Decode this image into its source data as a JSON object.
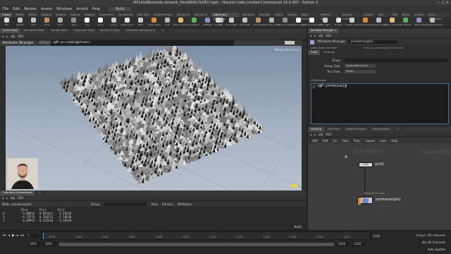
{
  "window": {
    "title": "/ATLAS/Work/edu-sk/work_files/BASICS/VEX.hiplc - Houdini Indie Limited-Commercial 19.0.455 - Python 3"
  },
  "menu": [
    "File",
    "Edit",
    "Render",
    "Assets",
    "Windows",
    "Arnold",
    "Help"
  ],
  "desktop": "Build",
  "shelf": {
    "left_tabs": [
      "Create",
      "Modify",
      "Model",
      "Polygon",
      "Deform",
      "Texture",
      "Rigging",
      "Characters",
      "Constraints",
      "Hair Utils",
      "Guide Process",
      "Terrain FX",
      "Simple FX",
      "Volume",
      "+"
    ],
    "right_tabs": [
      "Lights and Cameras",
      "Collisions",
      "Particles",
      "Grains",
      "Vellum",
      "Rigid Bodies",
      "Particle Fluids",
      "Viscous Fluids",
      "Oceans",
      "Pyro FX",
      "FEM",
      "Wires",
      "Crowds",
      "Drive Simulation"
    ],
    "left_tools": [
      "Box",
      "Sphere",
      "Tube",
      "Torus",
      "Grid",
      "Null",
      "Line",
      "Circle",
      "Curve",
      "Draw Curve",
      "Path",
      "Spray Paint",
      "Font",
      "Platonic Solids",
      "L-System",
      "Metaball",
      "File"
    ],
    "right_tools": [
      "Camera",
      "Point Light",
      "Spot Light",
      "Area Light",
      "Geometry Light",
      "Volume Light",
      "Distant Light",
      "Environment Light",
      "Sky Light",
      "GI Light",
      "Caustic Light",
      "Portal Light",
      "Ambient Light",
      "Stereo Camera",
      "VR Camera",
      "Switcher",
      "Gamepad Camera"
    ],
    "colors": [
      "#d9d9d9",
      "#c8c8c8",
      "#c0c0c0",
      "#c09060",
      "#b0b0b0",
      "#909090",
      "#ffffff",
      "#ffffff",
      "#c9c9c9",
      "#e0e0e0",
      "#cfcfcf",
      "#d98a3a",
      "#b8b8b8",
      "#e8c070",
      "#60b060",
      "#9090d0",
      "#bcbcbc"
    ]
  },
  "viewer_tabs": [
    "Scene View",
    "Animation Editor",
    "Render View",
    "Composite View",
    "Motion FX View",
    "Geometry Spreadsheet",
    "+"
  ],
  "viewer_path": {
    "obj": "obj",
    "node": "VEX"
  },
  "viewer_bar": {
    "title": "Attribute Wrangle",
    "context": "VEXpression"
  },
  "viewport_code": "v@P.y+=rand(@ptnum);",
  "viewport_label": "Persp",
  "cam_label": "No cam",
  "params_tabs": [
    "Attribute Wrangle  +"
  ],
  "params_path": {
    "obj": "obj",
    "node": "VEX"
  },
  "node_header": {
    "type": "Attribute Wrangle",
    "name": "pointwrangle1"
  },
  "params_info": "Asset Name and Path",
  "params_info_right": "opdef:/Sop/attribwrangle?Embedded",
  "params_tabsB": [
    "Code",
    "Bindings"
  ],
  "params_fields": [
    {
      "label": "Group",
      "value": ""
    },
    {
      "label": "Group Type",
      "value": "Guess from Group"
    },
    {
      "label": "Run Over",
      "value": "Points"
    }
  ],
  "params_vex_label": "VEXpression",
  "params_code": "v@P.y+=noise(@",
  "network_tabs": [
    "/obj/VEX",
    "Tree View",
    "Material Palette",
    "Asset Browser",
    "+"
  ],
  "network_path": {
    "obj": "obj",
    "node": "VEX"
  },
  "network_menu": [
    "Add",
    "Edit",
    "Go",
    "View",
    "Tools",
    "Layout",
    "Labs",
    "Help"
  ],
  "network_bg": {
    "left": "Indie Edition",
    "right": "Geometry"
  },
  "nodes": {
    "grid": {
      "name": "grid1",
      "tag": "Grid"
    },
    "wrangle": {
      "name": "pointwrangle1",
      "tag": "Attribute Wrangle"
    }
  },
  "spreadsheet": {
    "tabs": [
      "Geometry Spreadsheet",
      "+"
    ],
    "path": {
      "obj": "obj",
      "node": "VEX"
    },
    "node": "Node: pointwrangle1",
    "group_label": "Group:",
    "view_label": "View",
    "intrinsic_label": "Intrinsic",
    "attrib_label": "Attributes:",
    "columns": [
      "",
      "P[x]",
      "P[y]",
      "P[z]"
    ],
    "rows": [
      [
        "0",
        "-5.00854",
        "0.041651",
        "-5.10338"
      ],
      [
        "1",
        "-4.74753",
        "0.356251",
        "-5.10338"
      ],
      [
        "2",
        "-4.49932",
        "0.255544",
        "-5.10338"
      ]
    ],
    "scroll_label": "Node"
  },
  "timeline": {
    "frame": "1",
    "start": "1001",
    "end": "1240",
    "ticks": [
      "1008",
      "1025",
      "1040",
      "1060",
      "1080",
      "1100",
      "1120",
      "1140",
      "1160",
      "1180",
      "1200",
      "1220"
    ],
    "start_field": "1001",
    "start_field2": "1001",
    "end_field": "1240",
    "end_field2": "1240"
  },
  "status": {
    "keys": "0 keys, 0/0 channels",
    "key_all": "Key All Channels",
    "autoupdate": "Auto Update"
  }
}
